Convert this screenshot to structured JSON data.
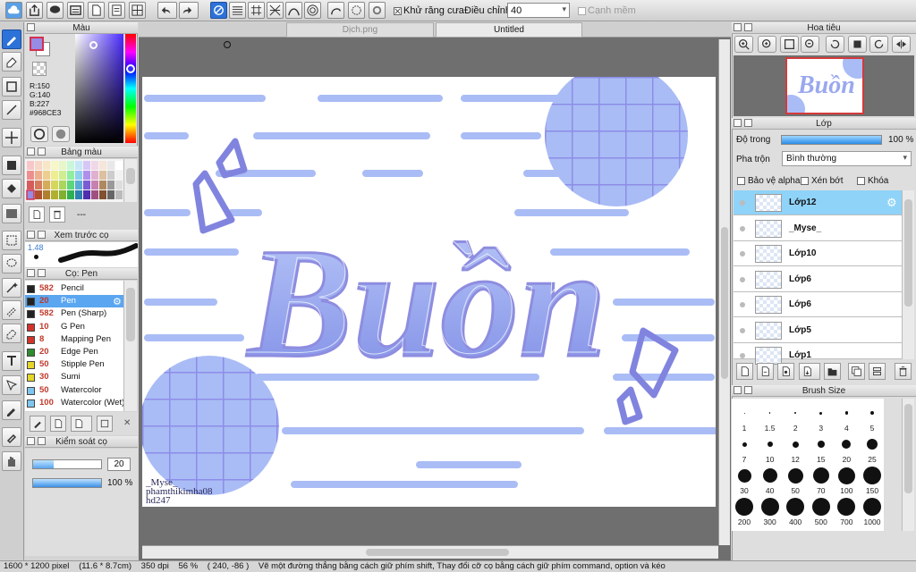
{
  "toolbar": {
    "antialias_label": "Khử răng cưa",
    "adjust_label": "Điều chỉnh",
    "adjust_value": "40",
    "snap_label": "Cạnh mềm"
  },
  "tabs": [
    {
      "label": "Dịch.png"
    },
    {
      "label": "Untitled"
    }
  ],
  "color_panel": {
    "title": "Màu",
    "r": "R:150",
    "g": "G:140",
    "b": "B:227",
    "hex": "#968CE3",
    "primary": "#968CE3"
  },
  "swatch_panel": {
    "title": "Bảng màu",
    "empty_label": "---"
  },
  "preview_panel": {
    "title": "Xem trước cọ",
    "size": "1.48"
  },
  "brush_panel": {
    "title": "Cọ: Pen",
    "items": [
      {
        "size": "582",
        "name": "Pencil",
        "color": "#222222"
      },
      {
        "size": "20",
        "name": "Pen",
        "color": "#222222"
      },
      {
        "size": "582",
        "name": "Pen (Sharp)",
        "color": "#222222"
      },
      {
        "size": "10",
        "name": "G Pen",
        "color": "#d0342c"
      },
      {
        "size": "8",
        "name": "Mapping Pen",
        "color": "#d0342c"
      },
      {
        "size": "20",
        "name": "Edge Pen",
        "color": "#2e8b2e"
      },
      {
        "size": "50",
        "name": "Stipple Pen",
        "color": "#e4d52a"
      },
      {
        "size": "30",
        "name": "Sumi",
        "color": "#e4d52a"
      },
      {
        "size": "50",
        "name": "Watercolor",
        "color": "#7fc6ef"
      },
      {
        "size": "100",
        "name": "Watercolor (Wet)",
        "color": "#7fc6ef"
      }
    ]
  },
  "control_panel": {
    "title": "Kiểm soát cọ",
    "size_value": "20",
    "opacity_value": "100 %",
    "size_fraction": 0.3,
    "opacity_fraction": 1.0
  },
  "navigator": {
    "title": "Hoa tiêu"
  },
  "layer_panel": {
    "title": "Lớp",
    "opacity_label": "Độ trong",
    "opacity_value": "100 %",
    "opacity_fraction": 1.0,
    "blend_label": "Pha trộn",
    "blend_value": "Bình thường",
    "protect_alpha": "Bảo vệ alpha",
    "clip": "Xén bớt",
    "lock": "Khóa",
    "layers": [
      {
        "name": "Lớp12"
      },
      {
        "name": "_Myse_"
      },
      {
        "name": "Lớp10"
      },
      {
        "name": "Lớp6"
      },
      {
        "name": "Lớp6"
      },
      {
        "name": "Lớp5"
      },
      {
        "name": "Lớp1"
      }
    ]
  },
  "brush_size": {
    "title": "Brush Size",
    "sizes": [
      "1",
      "1.5",
      "2",
      "3",
      "4",
      "5",
      "7",
      "10",
      "12",
      "15",
      "20",
      "25",
      "30",
      "40",
      "50",
      "70",
      "100",
      "150",
      "200",
      "300",
      "400",
      "500",
      "700",
      "1000"
    ]
  },
  "artwork": {
    "title_text": "Buồn",
    "credits": [
      "_Myse_",
      "phamthikimha08",
      "hd247"
    ],
    "bg": "#ffffff",
    "accent": "#a9bcf5",
    "stroke": "#8e8de0"
  },
  "status": {
    "size": "1600 * 1200 pixel",
    "dims": "(11.6 * 8.7cm)",
    "dpi": "350 dpi",
    "zoom": "56 %",
    "coords": "( 240, -86 )",
    "hint": "Vẽ một đường thẳng bằng cách giữ phím shift, Thay đổi cỡ cọ bằng cách giữ phím command, option và kéo"
  }
}
